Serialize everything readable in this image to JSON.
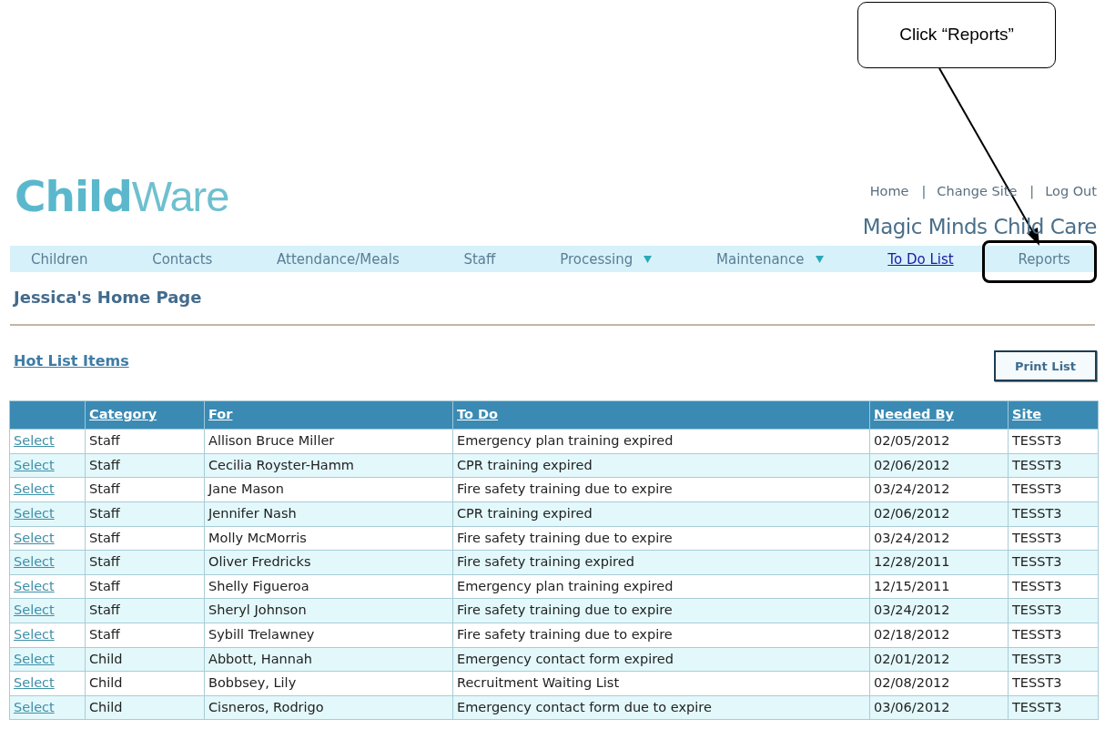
{
  "callout": {
    "text": "Click “Reports”"
  },
  "header": {
    "logo": {
      "bold_part": "Child",
      "light_part": "Ware"
    },
    "links": [
      "Home",
      "Change Site",
      "Log Out"
    ],
    "separators": [
      "|",
      "|"
    ],
    "site_name": "Magic Minds Child Care"
  },
  "nav": [
    {
      "label": "Children",
      "kind": "plain",
      "annotated": false
    },
    {
      "label": "Contacts",
      "kind": "plain",
      "annotated": false
    },
    {
      "label": "Attendance/Meals",
      "kind": "plain",
      "annotated": false
    },
    {
      "label": "Staff",
      "kind": "plain",
      "annotated": false
    },
    {
      "label": "Processing",
      "kind": "dropdown",
      "annotated": false
    },
    {
      "label": "Maintenance",
      "kind": "dropdown",
      "annotated": false
    },
    {
      "label": "To Do List",
      "kind": "link",
      "annotated": false
    },
    {
      "label": "Reports",
      "kind": "plain",
      "annotated": true
    }
  ],
  "page_title": "Jessica's Home Page",
  "hot_list": {
    "title": "Hot List Items",
    "print_button": "Print List",
    "table": {
      "columns": [
        "",
        "Category",
        "For",
        "To Do",
        "Needed By",
        "Site"
      ],
      "rows": [
        {
          "action": "Select",
          "category": "Staff",
          "for": "Allison Bruce Miller",
          "to_do": "Emergency plan training expired",
          "needed_by": "02/05/2012",
          "site": "TESST3"
        },
        {
          "action": "Select",
          "category": "Staff",
          "for": "Cecilia Royster-Hamm",
          "to_do": "CPR training expired",
          "needed_by": "02/06/2012",
          "site": "TESST3"
        },
        {
          "action": "Select",
          "category": "Staff",
          "for": "Jane Mason",
          "to_do": "Fire safety training due to expire",
          "needed_by": "03/24/2012",
          "site": "TESST3"
        },
        {
          "action": "Select",
          "category": "Staff",
          "for": "Jennifer Nash",
          "to_do": "CPR training expired",
          "needed_by": "02/06/2012",
          "site": "TESST3"
        },
        {
          "action": "Select",
          "category": "Staff",
          "for": "Molly McMorris",
          "to_do": "Fire safety training due to expire",
          "needed_by": "03/24/2012",
          "site": "TESST3"
        },
        {
          "action": "Select",
          "category": "Staff",
          "for": "Oliver Fredricks",
          "to_do": "Fire safety training expired",
          "needed_by": "12/28/2011",
          "site": "TESST3"
        },
        {
          "action": "Select",
          "category": "Staff",
          "for": "Shelly Figueroa",
          "to_do": "Emergency plan training expired",
          "needed_by": "12/15/2011",
          "site": "TESST3"
        },
        {
          "action": "Select",
          "category": "Staff",
          "for": "Sheryl Johnson",
          "to_do": "Fire safety training due to expire",
          "needed_by": "03/24/2012",
          "site": "TESST3"
        },
        {
          "action": "Select",
          "category": "Staff",
          "for": "Sybill Trelawney",
          "to_do": "Fire safety training due to expire",
          "needed_by": "02/18/2012",
          "site": "TESST3"
        },
        {
          "action": "Select",
          "category": "Child",
          "for": "Abbott, Hannah",
          "to_do": "Emergency contact form expired",
          "needed_by": "02/01/2012",
          "site": "TESST3"
        },
        {
          "action": "Select",
          "category": "Child",
          "for": "Bobbsey, Lily",
          "to_do": "Recruitment Waiting List",
          "needed_by": "02/08/2012",
          "site": "TESST3"
        },
        {
          "action": "Select",
          "category": "Child",
          "for": "Cisneros, Rodrigo",
          "to_do": "Emergency contact form due to expire",
          "needed_by": "03/06/2012",
          "site": "TESST3"
        }
      ]
    }
  }
}
